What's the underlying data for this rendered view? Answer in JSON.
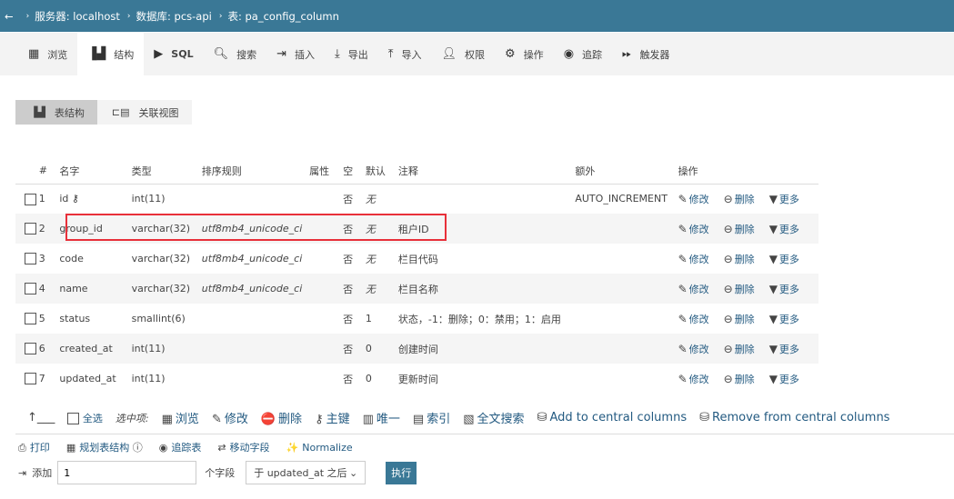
{
  "header": {
    "crumbs": [
      "服务器: localhost",
      "数据库: pcs-api",
      "表: pa_config_column"
    ]
  },
  "tabs": [
    {
      "label": "浏览",
      "icon": "browse-icon"
    },
    {
      "label": "结构",
      "icon": "structure-icon",
      "active": true
    },
    {
      "label": "SQL",
      "icon": "play-icon"
    },
    {
      "label": "搜索",
      "icon": "search-icon"
    },
    {
      "label": "插入",
      "icon": "insert-icon"
    },
    {
      "label": "导出",
      "icon": "download-icon"
    },
    {
      "label": "导入",
      "icon": "upload-icon"
    },
    {
      "label": "权限",
      "icon": "user-icon"
    },
    {
      "label": "操作",
      "icon": "gear-icon"
    },
    {
      "label": "追踪",
      "icon": "eye-icon"
    },
    {
      "label": "触发器",
      "icon": "fast-forward-icon"
    }
  ],
  "subtabs": [
    {
      "label": "表结构"
    },
    {
      "label": "关联视图"
    }
  ],
  "table": {
    "headers": [
      "#",
      "名字",
      "类型",
      "排序规则",
      "属性",
      "空",
      "默认",
      "注释",
      "额外",
      "操作"
    ],
    "rows": [
      {
        "n": "1",
        "name": "id",
        "type": "int(11)",
        "coll": "",
        "attr": "",
        "null": "否",
        "def": "无",
        "comment": "",
        "extra": "AUTO_INCREMENT",
        "primary": true
      },
      {
        "n": "2",
        "name": "group_id",
        "type": "varchar(32)",
        "coll": "utf8mb4_unicode_ci",
        "attr": "",
        "null": "否",
        "def": "无",
        "comment": "租户ID",
        "extra": "",
        "highlighted": true
      },
      {
        "n": "3",
        "name": "code",
        "type": "varchar(32)",
        "coll": "utf8mb4_unicode_ci",
        "attr": "",
        "null": "否",
        "def": "无",
        "comment": "栏目代码",
        "extra": ""
      },
      {
        "n": "4",
        "name": "name",
        "type": "varchar(32)",
        "coll": "utf8mb4_unicode_ci",
        "attr": "",
        "null": "否",
        "def": "无",
        "comment": "栏目名称",
        "extra": ""
      },
      {
        "n": "5",
        "name": "status",
        "type": "smallint(6)",
        "coll": "",
        "attr": "",
        "null": "否",
        "def": "1",
        "comment": "状态，-1：删除；0：禁用；1：启用",
        "extra": ""
      },
      {
        "n": "6",
        "name": "created_at",
        "type": "int(11)",
        "coll": "",
        "attr": "",
        "null": "否",
        "def": "0",
        "comment": "创建时间",
        "extra": ""
      },
      {
        "n": "7",
        "name": "updated_at",
        "type": "int(11)",
        "coll": "",
        "attr": "",
        "null": "否",
        "def": "0",
        "comment": "更新时间",
        "extra": ""
      }
    ],
    "actions": {
      "edit": "修改",
      "drop": "删除",
      "more": "更多"
    }
  },
  "bulk": {
    "select_all": "全选",
    "with_selected": "选中项:",
    "browse": "浏览",
    "edit": "修改",
    "drop": "删除",
    "primary": "主键",
    "unique": "唯一",
    "index": "索引",
    "fulltext": "全文搜索",
    "add_central": "Add to central columns",
    "remove_central": "Remove from central columns"
  },
  "tools": {
    "print": "打印",
    "propose": "规划表结构",
    "track": "追踪表",
    "move": "移动字段",
    "normalize": "Normalize"
  },
  "add": {
    "label": "添加",
    "count": "1",
    "fields_label": "个字段",
    "position": "于 updated_at 之后",
    "go": "执行"
  },
  "colors": {
    "header": "#3a7896",
    "link": "#235a81",
    "highlight": "#e8303a"
  }
}
